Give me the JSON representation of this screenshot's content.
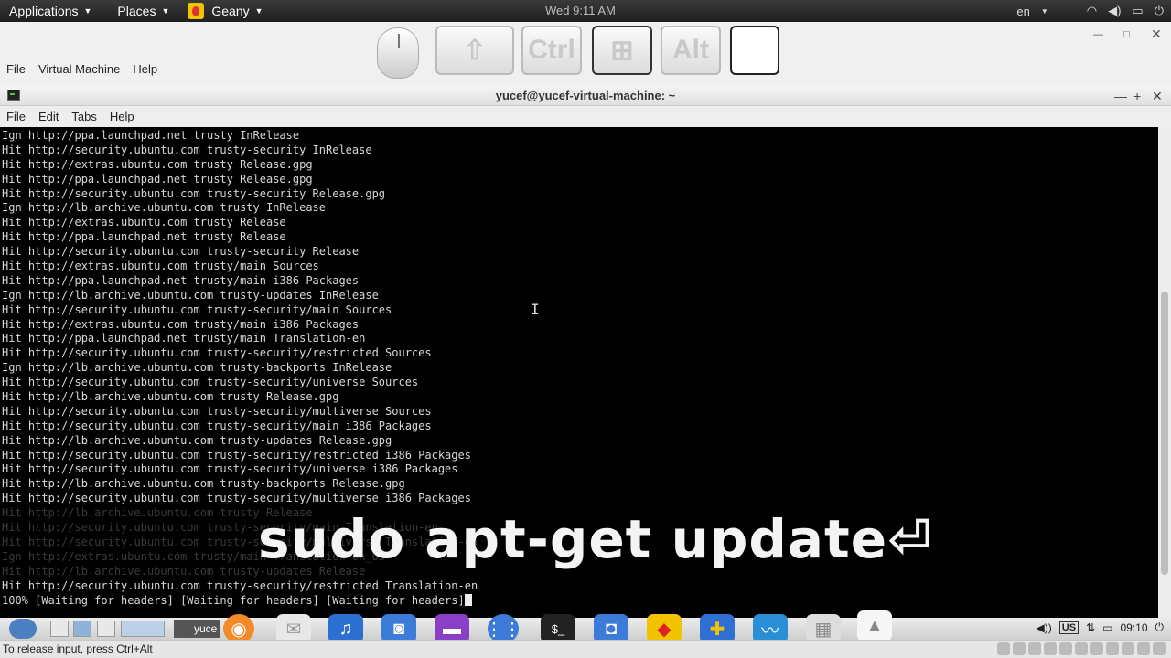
{
  "top_panel": {
    "applications": "Applications",
    "places": "Places",
    "geany": "Geany",
    "clock": "Wed  9:11 AM",
    "lang": "en"
  },
  "vm": {
    "menu": [
      "File",
      "Virtual Machine",
      "Help"
    ],
    "keys": [
      "Ctrl",
      "Alt"
    ]
  },
  "terminal": {
    "title": "yucef@yucef-virtual-machine: ~",
    "menu": [
      "File",
      "Edit",
      "Tabs",
      "Help"
    ],
    "lines": [
      {
        "text": "Ign http://ppa.launchpad.net trusty InRelease",
        "dim": false
      },
      {
        "text": "Hit http://security.ubuntu.com trusty-security InRelease",
        "dim": false
      },
      {
        "text": "Hit http://extras.ubuntu.com trusty Release.gpg",
        "dim": false
      },
      {
        "text": "Hit http://ppa.launchpad.net trusty Release.gpg",
        "dim": false
      },
      {
        "text": "Hit http://security.ubuntu.com trusty-security Release.gpg",
        "dim": false
      },
      {
        "text": "Ign http://lb.archive.ubuntu.com trusty InRelease",
        "dim": false
      },
      {
        "text": "Hit http://extras.ubuntu.com trusty Release",
        "dim": false
      },
      {
        "text": "Hit http://ppa.launchpad.net trusty Release",
        "dim": false
      },
      {
        "text": "Hit http://security.ubuntu.com trusty-security Release",
        "dim": false
      },
      {
        "text": "Hit http://extras.ubuntu.com trusty/main Sources",
        "dim": false
      },
      {
        "text": "Hit http://ppa.launchpad.net trusty/main i386 Packages",
        "dim": false
      },
      {
        "text": "Ign http://lb.archive.ubuntu.com trusty-updates InRelease",
        "dim": false
      },
      {
        "text": "Hit http://security.ubuntu.com trusty-security/main Sources",
        "dim": false
      },
      {
        "text": "Hit http://extras.ubuntu.com trusty/main i386 Packages",
        "dim": false
      },
      {
        "text": "Hit http://ppa.launchpad.net trusty/main Translation-en",
        "dim": false
      },
      {
        "text": "Hit http://security.ubuntu.com trusty-security/restricted Sources",
        "dim": false
      },
      {
        "text": "Ign http://lb.archive.ubuntu.com trusty-backports InRelease",
        "dim": false
      },
      {
        "text": "Hit http://security.ubuntu.com trusty-security/universe Sources",
        "dim": false
      },
      {
        "text": "Hit http://lb.archive.ubuntu.com trusty Release.gpg",
        "dim": false
      },
      {
        "text": "Hit http://security.ubuntu.com trusty-security/multiverse Sources",
        "dim": false
      },
      {
        "text": "Hit http://security.ubuntu.com trusty-security/main i386 Packages",
        "dim": false
      },
      {
        "text": "Hit http://lb.archive.ubuntu.com trusty-updates Release.gpg",
        "dim": false
      },
      {
        "text": "Hit http://security.ubuntu.com trusty-security/restricted i386 Packages",
        "dim": false
      },
      {
        "text": "Hit http://security.ubuntu.com trusty-security/universe i386 Packages",
        "dim": false
      },
      {
        "text": "Hit http://lb.archive.ubuntu.com trusty-backports Release.gpg",
        "dim": false
      },
      {
        "text": "Hit http://security.ubuntu.com trusty-security/multiverse i386 Packages",
        "dim": false
      },
      {
        "text": "Hit http://lb.archive.ubuntu.com trusty Release",
        "dim": true
      },
      {
        "text": "Hit http://security.ubuntu.com trusty-security/main Translation-en",
        "dim": true
      },
      {
        "text": "Hit http://security.ubuntu.com trusty-security/multiverse Translation-en",
        "dim": true
      },
      {
        "text": "Ign http://extras.ubuntu.com trusty/main Translation-en_US",
        "dim": true
      },
      {
        "text": "Hit http://lb.archive.ubuntu.com trusty-updates Release",
        "dim": true
      },
      {
        "text": "Hit http://security.ubuntu.com trusty-security/restricted Translation-en",
        "dim": false
      },
      {
        "text": "100% [Waiting for headers] [Waiting for headers] [Waiting for headers]",
        "dim": false,
        "cursor": true
      }
    ]
  },
  "caption": "sudo apt-get update⏎",
  "dock": {
    "window_label": "yuce",
    "tray_lang": "US",
    "tray_time": "09:10"
  },
  "statusbar": {
    "text": "To release input, press Ctrl+Alt"
  }
}
